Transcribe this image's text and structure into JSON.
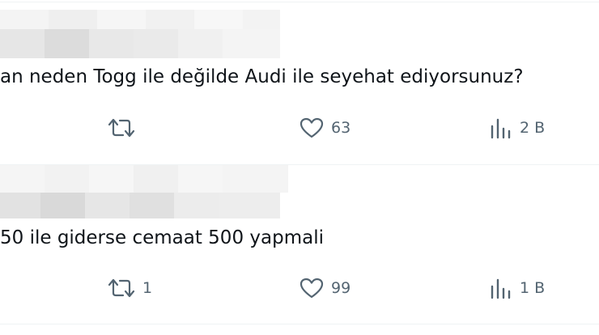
{
  "colors": {
    "text": "#0f1419",
    "muted": "#536471",
    "divider": "#eff3f4"
  },
  "tweets": [
    {
      "text": "an neden Togg ile değilde Audi ile seyehat ediyorsunuz?",
      "retweets": "",
      "likes": "63",
      "views": "2 B",
      "icons": [
        "retweet-icon",
        "heart-icon",
        "views-icon"
      ]
    },
    {
      "text": "50 ile giderse cemaat 500 yapmali",
      "retweets": "1",
      "likes": "99",
      "views": "1 B",
      "icons": [
        "retweet-icon",
        "heart-icon",
        "views-icon"
      ]
    }
  ]
}
